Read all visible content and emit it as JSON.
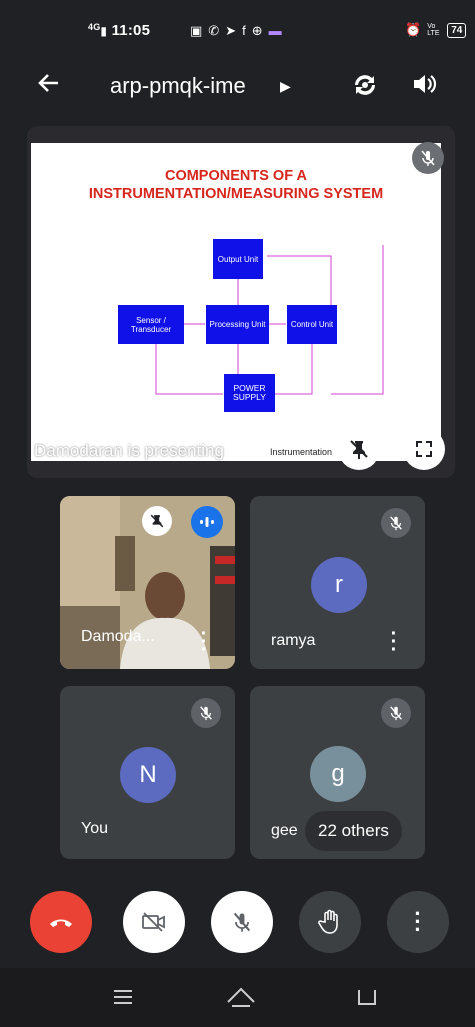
{
  "status_bar": {
    "network": "4G",
    "time": "11:05",
    "volte": "Vo LTE",
    "battery": "74"
  },
  "header": {
    "meeting_code": "arp-pmqk-ime"
  },
  "presentation": {
    "slide": {
      "title_line1": "COMPONENTS OF A",
      "title_line2": "INSTRUMENTATION/MEASURING SYSTEM",
      "output_unit": "Output Unit",
      "sensor": "Sensor / Transducer",
      "processing": "Processing Unit",
      "control": "Control Unit",
      "power": "POWER SUPPLY",
      "footer_tail": "Instrumentation"
    },
    "presenting_label": "Damodaran is presenting"
  },
  "participants": [
    {
      "name": "Damoda...",
      "initial": ""
    },
    {
      "name": "ramya",
      "initial": "r",
      "color": "#5c6bc0"
    },
    {
      "name": "You",
      "initial": "N",
      "color": "#5c6bc0"
    },
    {
      "name": "gee",
      "initial": "g",
      "color": "#78909c"
    }
  ],
  "others_chip": "22 others",
  "colors": {
    "end_call": "#ea4335",
    "background": "#202124",
    "tile": "#3c4043"
  }
}
